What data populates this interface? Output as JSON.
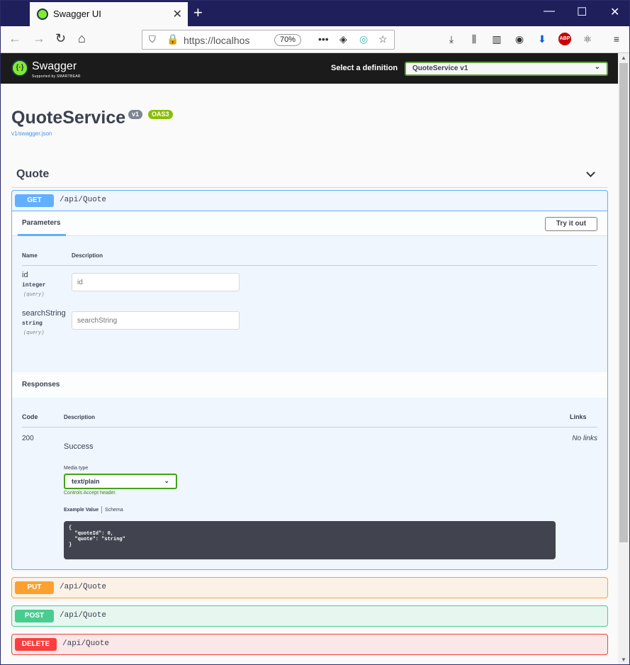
{
  "browser": {
    "tab_title": "Swagger UI",
    "url": "https://localhost",
    "zoom": "70%"
  },
  "header": {
    "logo_text": "Swagger",
    "logo_sub": "Supported by SMARTBEAR",
    "definition_label": "Select a definition",
    "definition_value": "QuoteService v1"
  },
  "info": {
    "title": "QuoteService",
    "version_badge": "v1",
    "oas_badge": "OAS3",
    "spec_link": "v1/swagger.json"
  },
  "tag": {
    "name": "Quote"
  },
  "operations": [
    {
      "method": "GET",
      "path": "/api/Quote"
    },
    {
      "method": "PUT",
      "path": "/api/Quote"
    },
    {
      "method": "POST",
      "path": "/api/Quote"
    },
    {
      "method": "DELETE",
      "path": "/api/Quote"
    }
  ],
  "get_detail": {
    "params_tab": "Parameters",
    "try_it_out": "Try it out",
    "col_name": "Name",
    "col_description": "Description",
    "params": [
      {
        "name": "id",
        "type": "integer",
        "in": "(query)",
        "placeholder": "id"
      },
      {
        "name": "searchString",
        "type": "string",
        "in": "(query)",
        "placeholder": "searchString"
      }
    ],
    "responses_title": "Responses",
    "resp_col_code": "Code",
    "resp_col_description": "Description",
    "resp_col_links": "Links",
    "response_code": "200",
    "response_desc": "Success",
    "no_links": "No links",
    "media_type_label": "Media type",
    "media_type_value": "text/plain",
    "controls_text": "Controls Accept header.",
    "example_value_tab": "Example Value",
    "schema_tab": "Schema",
    "example_code": "{\n  \"quoteId\": 0,\n  \"quote\": \"string\"\n}"
  },
  "colors": {
    "get": "#61affe",
    "put": "#fca130",
    "post": "#49cc90",
    "delete": "#f93e3e",
    "brand_green": "#85ea2d"
  }
}
